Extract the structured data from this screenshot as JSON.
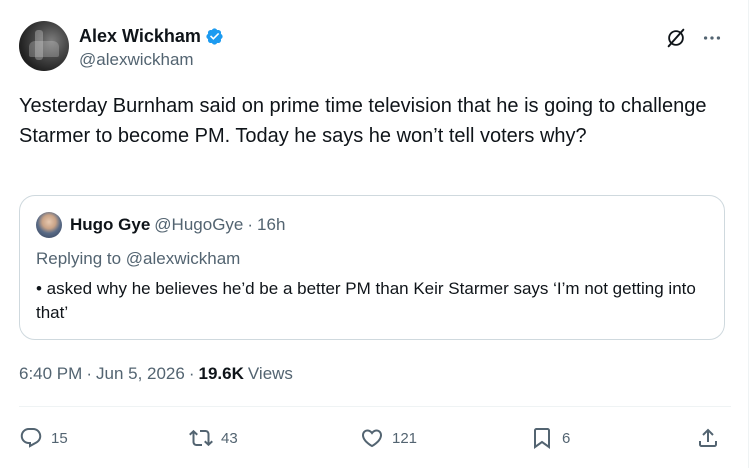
{
  "author": {
    "display_name": "Alex Wickham",
    "handle": "@alexwickham"
  },
  "tweet": {
    "text": "Yesterday Burnham said on prime time television that he is going to challenge Starmer to become PM. Today he says he won’t tell voters why?"
  },
  "quote": {
    "display_name": "Hugo Gye",
    "handle": "@HugoGye",
    "separator": "·",
    "time": "16h",
    "replying_to": "Replying to @alexwickham",
    "text": "• asked why he believes he’d be a better PM than Keir Starmer says ‘I’m not getting into that’"
  },
  "meta": {
    "time": "6:40 PM",
    "separator1": "·",
    "date": "Jun 5, 2026",
    "separator2": "·",
    "views_count": "19.6K",
    "views_label": "Views"
  },
  "actions": {
    "replies": "15",
    "reposts": "43",
    "likes": "121",
    "bookmarks": "6"
  },
  "icons": {
    "verified": "verified-badge-icon",
    "grok": "grok-icon",
    "more": "more-icon",
    "reply": "reply-icon",
    "repost": "repost-icon",
    "like": "like-icon",
    "bookmark": "bookmark-icon",
    "share": "share-icon"
  },
  "colors": {
    "verified": "#1d9bf0",
    "text_primary": "#0f1419",
    "text_secondary": "#536471",
    "border": "#cfd9de"
  }
}
